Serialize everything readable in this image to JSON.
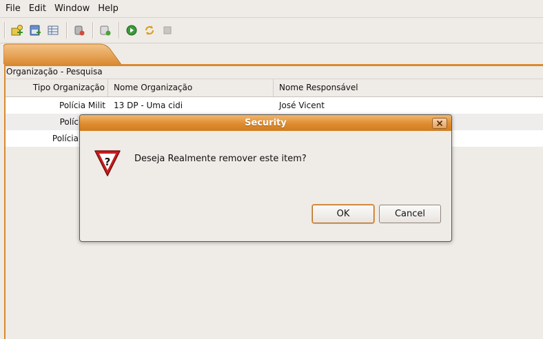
{
  "menubar": {
    "items": [
      {
        "label": "File"
      },
      {
        "label": "Edit"
      },
      {
        "label": "Window"
      },
      {
        "label": "Help"
      }
    ]
  },
  "toolbar": {
    "icons": [
      "new-folder-icon",
      "database-icon",
      "table-icon",
      "delete-icon",
      "add-icon",
      "run-icon",
      "refresh-icon",
      "stop-icon"
    ]
  },
  "panel": {
    "title": "Organização - Pesquisa"
  },
  "table": {
    "columns": [
      "Tipo Organização",
      "Nome Organização",
      "Nome Responsável"
    ],
    "rows": [
      {
        "tipo": "Polícia Milit",
        "nome": "13 DP - Uma cidi",
        "responsavel": "José Vicent"
      },
      {
        "tipo": "Políc",
        "nome": "",
        "responsavel": ""
      },
      {
        "tipo": "Polícia",
        "nome": "",
        "responsavel": ""
      }
    ]
  },
  "dialog": {
    "title": "Security",
    "message": "Deseja Realmente remover este item?",
    "ok_label": "OK",
    "cancel_label": "Cancel",
    "icon": "question-warning-icon"
  },
  "colors": {
    "accent": "#d9892f",
    "background": "#efebe7"
  }
}
